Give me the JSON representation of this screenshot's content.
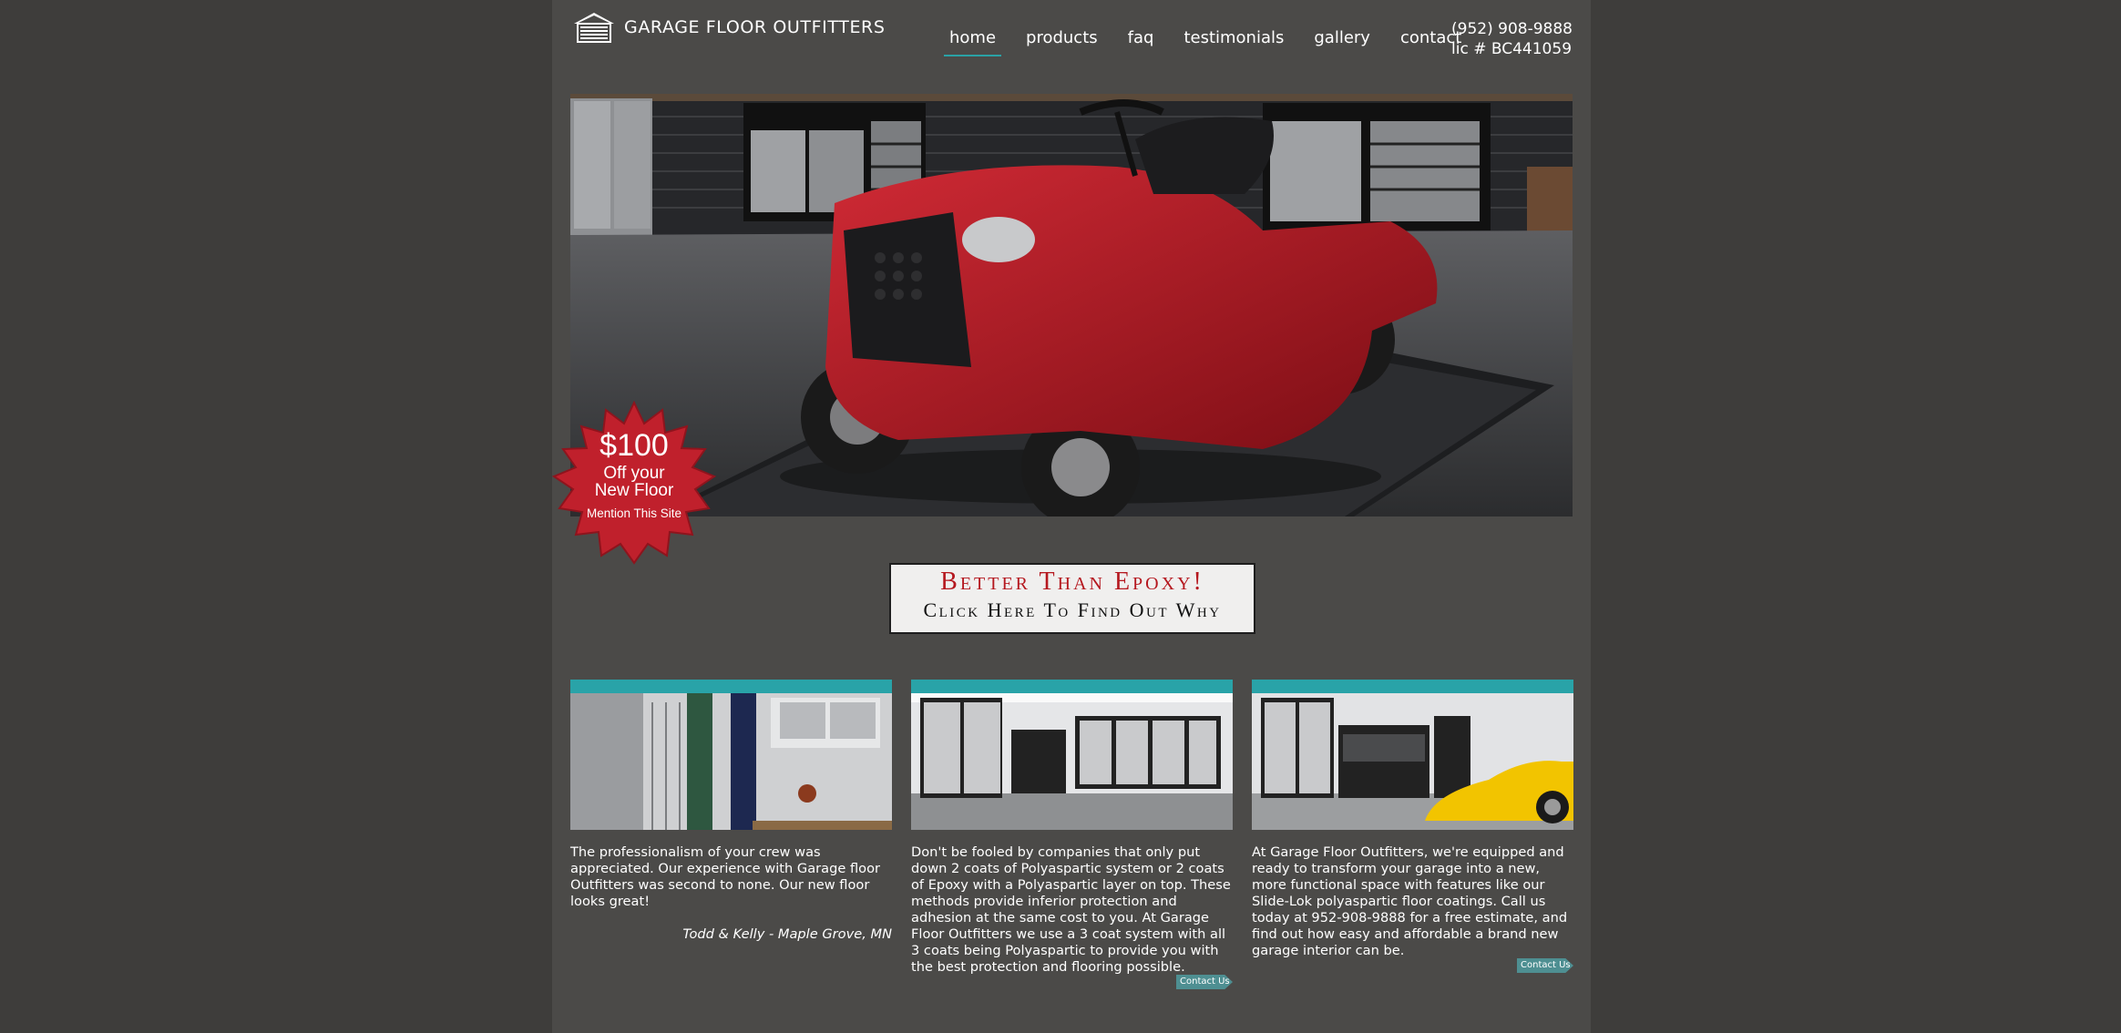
{
  "header": {
    "logo_text": "GARAGE FLOOR OUTFITTERS",
    "phone": "(952) 908-9888",
    "license": "lic # BC441059"
  },
  "nav": {
    "items": [
      {
        "label": "home",
        "active": true
      },
      {
        "label": "products",
        "active": false
      },
      {
        "label": "faq",
        "active": false
      },
      {
        "label": "testimonials",
        "active": false
      },
      {
        "label": "gallery",
        "active": false
      },
      {
        "label": "contact",
        "active": false
      }
    ]
  },
  "promo": {
    "price": "$100",
    "line1": "Off your",
    "line2": "New Floor",
    "mention": "Mention This Site"
  },
  "cta": {
    "line1": "Better Than Epoxy!",
    "line2": "Click Here To Find Out Why"
  },
  "columns": [
    {
      "text": "The professionalism of your crew was appreciated. Our experience with Garage floor Outfitters was second to none. Our new floor looks great!",
      "attribution": "Todd & Kelly - Maple Grove, MN"
    },
    {
      "text": "Don't be fooled by companies that only put down 2 coats of Polyaspartic system or 2 coats of Epoxy with a Polyaspartic layer on top. These methods provide inferior protection and adhesion at the same cost to you. At Garage Floor Outfitters we use a 3 coat system with all 3 coats being Polyaspartic to provide you with the best protection and flooring possible.",
      "button": "Contact Us"
    },
    {
      "text": "At Garage Floor Outfitters, we're equipped and ready to transform your garage into a new, more functional space with features like our Slide-Lok polyaspartic floor coatings. Call us today at 952-908-9888 for a free estimate, and find out how easy and affordable a brand new garage interior can be.",
      "button": "Contact Us"
    }
  ],
  "colors": {
    "accent": "#29a3a8",
    "page_bg": "#3e3d3b",
    "content_bg": "#4b4a48",
    "cta_red": "#b5181f",
    "starburst": "#c0202c"
  }
}
